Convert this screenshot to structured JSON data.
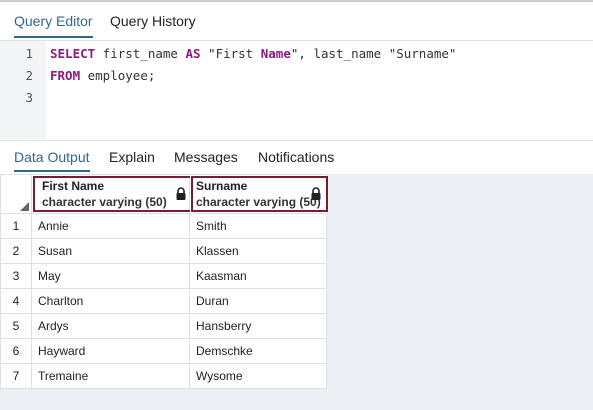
{
  "top_tabs": [
    "Query Editor",
    "Query History"
  ],
  "editor": {
    "line_numbers": [
      "1",
      "2",
      "3"
    ],
    "lines": [
      [
        {
          "t": "SELECT",
          "k": true
        },
        {
          "t": " first_name ",
          "k": false
        },
        {
          "t": "AS",
          "k": true
        },
        {
          "t": " \"First ",
          "k": false
        },
        {
          "t": "Name",
          "k": true
        },
        {
          "t": "\", last_name \"Surname\"",
          "k": false
        }
      ],
      [
        {
          "t": "FROM",
          "k": true
        },
        {
          "t": " employee;",
          "k": false
        }
      ],
      []
    ]
  },
  "result_tabs": [
    "Data Output",
    "Explain",
    "Messages",
    "Notifications"
  ],
  "grid": {
    "columns": [
      {
        "name": "First Name",
        "type": "character varying (50)"
      },
      {
        "name": "Surname",
        "type": "character varying (50)"
      }
    ],
    "rows": [
      [
        "1",
        "Annie",
        "Smith"
      ],
      [
        "2",
        "Susan",
        "Klassen"
      ],
      [
        "3",
        "May",
        "Kaasman"
      ],
      [
        "4",
        "Charlton",
        "Duran"
      ],
      [
        "5",
        "Ardys",
        "Hansberry"
      ],
      [
        "6",
        "Hayward",
        "Demschke"
      ],
      [
        "7",
        "Tremaine",
        "Wysome"
      ]
    ]
  },
  "colors": {
    "accent": "#326690",
    "highlight_border": "#7b1b2e",
    "keyword": "#8b1b7f"
  }
}
